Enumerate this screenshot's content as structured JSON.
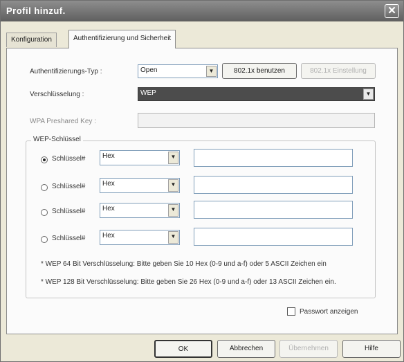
{
  "window": {
    "title": "Profil hinzuf."
  },
  "tabs": [
    {
      "label": "Konfiguration",
      "active": false
    },
    {
      "label": "Authentifizierung und Sicherheit",
      "active": true
    }
  ],
  "auth": {
    "label": "Authentifizierungs-Typ :",
    "value": "Open",
    "btn_8021x_use": "802.1x benutzen",
    "btn_8021x_settings": "802.1x Einstellung"
  },
  "encryption": {
    "label": "Verschlüsselung :",
    "value": "WEP"
  },
  "wpa": {
    "label": "WPA Preshared Key :",
    "value": ""
  },
  "wep": {
    "group_label": "WEP-Schlüssel",
    "keys": [
      {
        "label": "Schlüssel#",
        "format": "Hex",
        "value": "",
        "selected": true
      },
      {
        "label": "Schlüssel#",
        "format": "Hex",
        "value": "",
        "selected": false
      },
      {
        "label": "Schlüssel#",
        "format": "Hex",
        "value": "",
        "selected": false
      },
      {
        "label": "Schlüssel#",
        "format": "Hex",
        "value": "",
        "selected": false
      }
    ],
    "note_64": "* WEP 64 Bit Verschlüsselung: Bitte geben Sie 10 Hex (0-9 und a-f) oder 5 ASCII Zeichen ein",
    "note_128": "* WEP 128 Bit Verschlüsselung: Bitte geben Sie 26 Hex (0-9 und a-f) oder 13 ASCII Zeichen ein."
  },
  "show_password": {
    "label": "Passwort anzeigen",
    "checked": false
  },
  "footer": {
    "ok": "OK",
    "cancel": "Abbrechen",
    "apply": "Übernehmen",
    "help": "Hilfe"
  }
}
